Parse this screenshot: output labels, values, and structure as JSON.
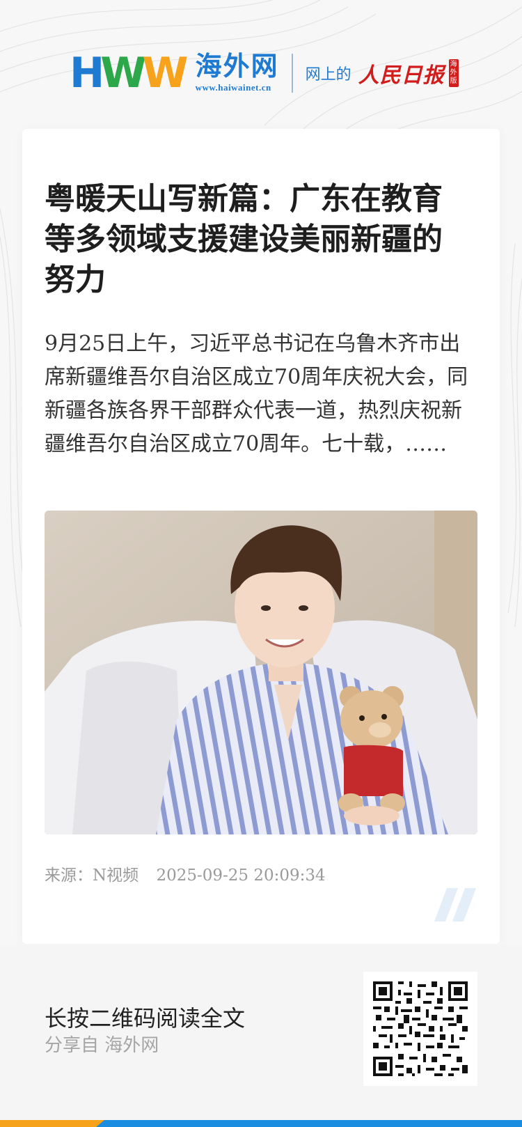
{
  "header": {
    "logo_letters": [
      "H",
      "W",
      "W"
    ],
    "logo_cn": "海外网",
    "logo_url": "www.haiwainet.cn",
    "tagline": "网上的",
    "partner_name": "人民日报",
    "partner_edition": "海外版"
  },
  "article": {
    "title": "粤暖天山写新篇：广东在教育等多领域支援建设美丽新疆的努力",
    "summary": "9月25日上午，习近平总书记在乌鲁木齐市出席新疆维吾尔自治区成立70周年庆祝大会，同新疆各族各界干部群众代表一道，热烈庆祝新疆维吾尔自治区成立70周年。七十载，……",
    "source": "来源：N视频",
    "datetime": "2025-09-25 20:09:34"
  },
  "footer": {
    "cta": "长按二维码阅读全文",
    "shared_from": "分享自 海外网"
  },
  "colors": {
    "brand_blue": "#1f7bd1",
    "brand_green": "#2ca84a",
    "brand_orange": "#f6a21a",
    "renmin_red": "#d21d1d"
  },
  "icons": [
    "quote-mark-icon",
    "qr-code"
  ]
}
